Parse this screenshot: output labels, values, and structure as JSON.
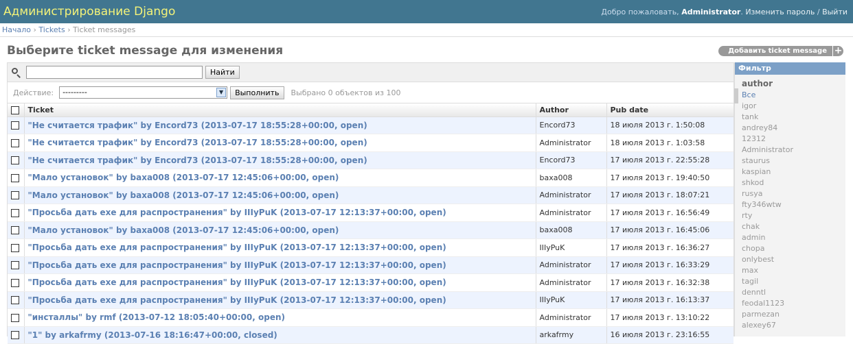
{
  "header": {
    "branding": "Администрирование Django",
    "welcome": "Добро пожаловать,",
    "user": "Administrator",
    "change_password": "Изменить пароль",
    "separator": "/",
    "logout": "Выйти"
  },
  "breadcrumbs": {
    "home": "Начало",
    "app": "Tickets",
    "current": "Ticket messages",
    "sep": "›"
  },
  "page": {
    "title": "Выберите ticket message для изменения",
    "add_button": "Добавить ticket message",
    "add_icon": "+"
  },
  "search": {
    "value": "",
    "button": "Найти"
  },
  "actions": {
    "label": "Действие:",
    "selected": "---------",
    "go": "Выполнить",
    "counter": "Выбрано 0 объектов из 100"
  },
  "table": {
    "headers": [
      "Ticket",
      "Author",
      "Pub date"
    ],
    "rows": [
      {
        "ticket": "\"Не считается трафик\" by Encord73 (2013-07-17 18:55:28+00:00, open)",
        "author": "Encord73",
        "date": "18 июля 2013 г. 1:50:08"
      },
      {
        "ticket": "\"Не считается трафик\" by Encord73 (2013-07-17 18:55:28+00:00, open)",
        "author": "Administrator",
        "date": "18 июля 2013 г. 1:03:58"
      },
      {
        "ticket": "\"Не считается трафик\" by Encord73 (2013-07-17 18:55:28+00:00, open)",
        "author": "Encord73",
        "date": "17 июля 2013 г. 22:55:28"
      },
      {
        "ticket": "\"Мало установок\" by baxa008 (2013-07-17 12:45:06+00:00, open)",
        "author": "baxa008",
        "date": "17 июля 2013 г. 19:40:50"
      },
      {
        "ticket": "\"Мало установок\" by baxa008 (2013-07-17 12:45:06+00:00, open)",
        "author": "Administrator",
        "date": "17 июля 2013 г. 18:07:21"
      },
      {
        "ticket": "\"Просьба дать exe для распространения\" by IIIyPuK (2013-07-17 12:13:37+00:00, open)",
        "author": "Administrator",
        "date": "17 июля 2013 г. 16:56:49"
      },
      {
        "ticket": "\"Мало установок\" by baxa008 (2013-07-17 12:45:06+00:00, open)",
        "author": "baxa008",
        "date": "17 июля 2013 г. 16:45:06"
      },
      {
        "ticket": "\"Просьба дать exe для распространения\" by IIIyPuK (2013-07-17 12:13:37+00:00, open)",
        "author": "IIIyPuK",
        "date": "17 июля 2013 г. 16:36:27"
      },
      {
        "ticket": "\"Просьба дать exe для распространения\" by IIIyPuK (2013-07-17 12:13:37+00:00, open)",
        "author": "Administrator",
        "date": "17 июля 2013 г. 16:33:29"
      },
      {
        "ticket": "\"Просьба дать exe для распространения\" by IIIyPuK (2013-07-17 12:13:37+00:00, open)",
        "author": "Administrator",
        "date": "17 июля 2013 г. 16:32:38"
      },
      {
        "ticket": "\"Просьба дать exe для распространения\" by IIIyPuK (2013-07-17 12:13:37+00:00, open)",
        "author": "IIIyPuK",
        "date": "17 июля 2013 г. 16:13:37"
      },
      {
        "ticket": "\"инсталлы\" by rmf (2013-07-12 18:05:40+00:00, open)",
        "author": "Administrator",
        "date": "17 июля 2013 г. 13:10:22"
      },
      {
        "ticket": "\"1\" by arkafrmy (2013-07-16 18:16:47+00:00, closed)",
        "author": "arkafrmy",
        "date": "16 июля 2013 г. 23:16:55"
      }
    ]
  },
  "filter": {
    "title": "Фильтр",
    "field": "author",
    "items": [
      "Все",
      "igor",
      "tank",
      "andrey84",
      "12312",
      "Administrator",
      "staurus",
      "kaspian",
      "shkod",
      "rusya",
      "fty346wtw",
      "rty",
      "chak",
      "admin",
      "chopa",
      "onlybest",
      "max",
      "tagil",
      "denntl",
      "feodal1123",
      "parmezan",
      "alexey67"
    ]
  }
}
